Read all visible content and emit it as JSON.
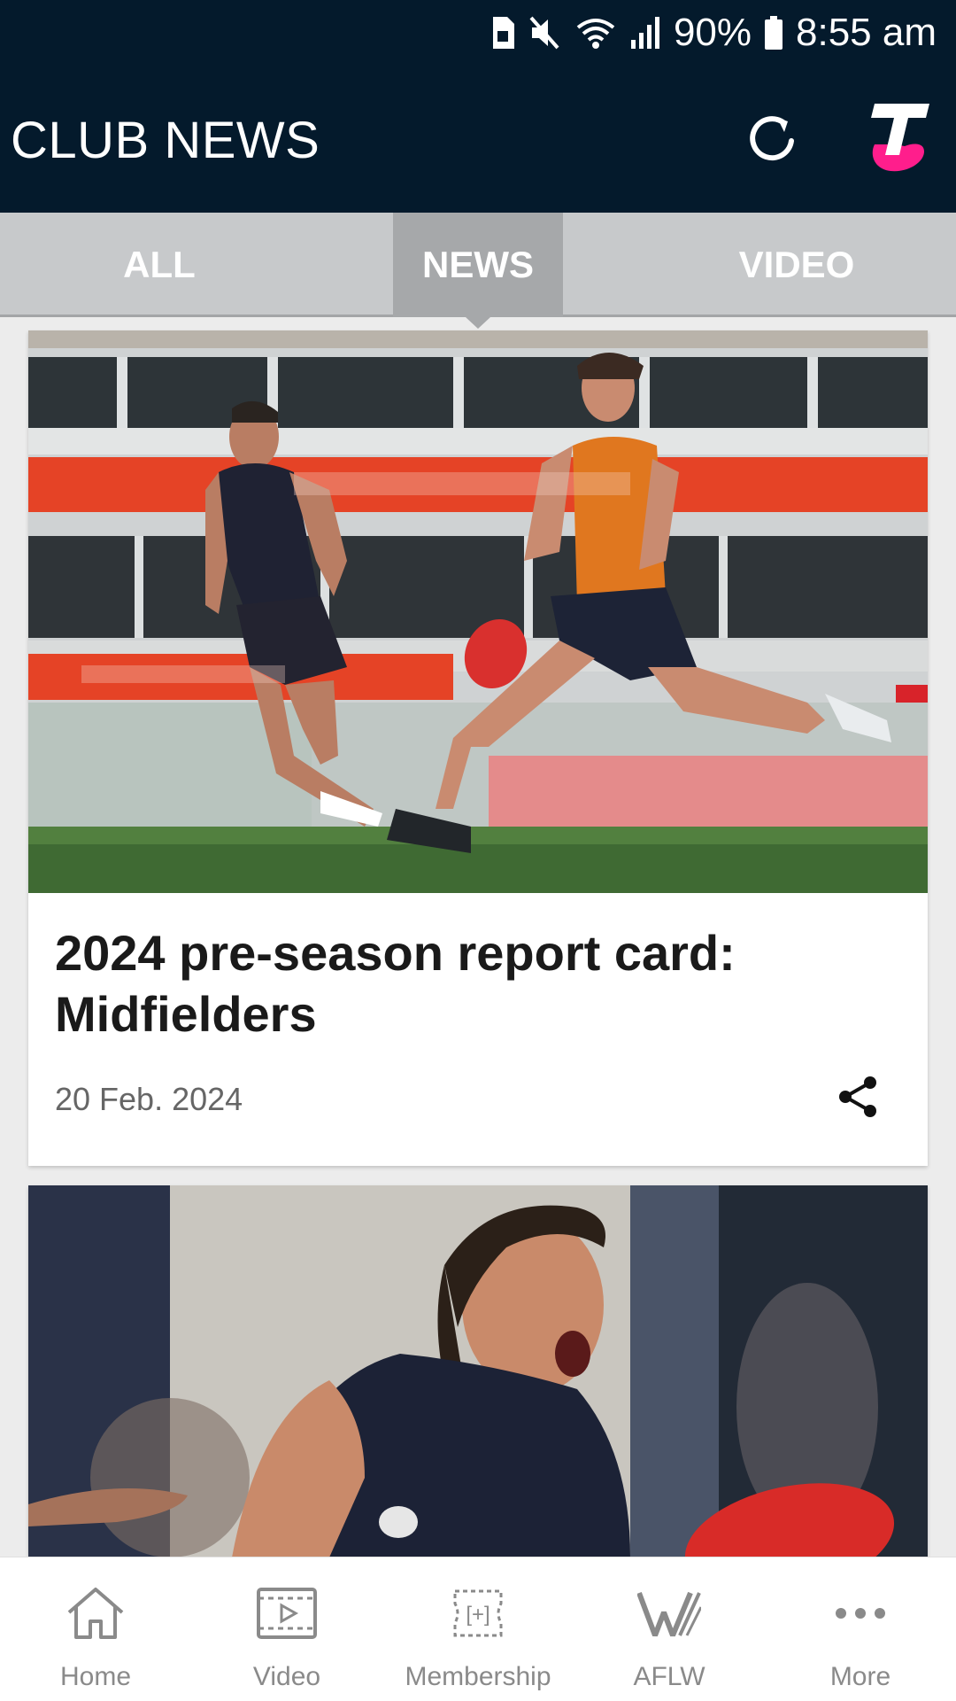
{
  "status_bar": {
    "battery_percent": "90%",
    "time": "8:55 am"
  },
  "app_bar": {
    "title": "CLUB NEWS",
    "refresh_icon": "refresh-icon",
    "brand_logo": "telstra-logo",
    "brand_color": "#ff1e8c"
  },
  "tabs": [
    {
      "label": "ALL",
      "selected": false
    },
    {
      "label": "NEWS",
      "selected": true
    },
    {
      "label": "VIDEO",
      "selected": false
    }
  ],
  "articles": [
    {
      "title": "2024 pre-season report card: Midfielders",
      "date": "20 Feb. 2024",
      "share_icon": "share-icon"
    },
    {
      "title": "",
      "date": ""
    }
  ],
  "bottom_nav": [
    {
      "label": "Home",
      "icon": "home-icon"
    },
    {
      "label": "Video",
      "icon": "video-icon"
    },
    {
      "label": "Membership",
      "icon": "membership-icon"
    },
    {
      "label": "AFLW",
      "icon": "aflw-icon"
    },
    {
      "label": "More",
      "icon": "more-icon"
    }
  ],
  "colors": {
    "header_bg": "#041a2c",
    "tab_bar_bg": "#c7c9cb",
    "tab_selected_bg": "#a6a8aa"
  }
}
